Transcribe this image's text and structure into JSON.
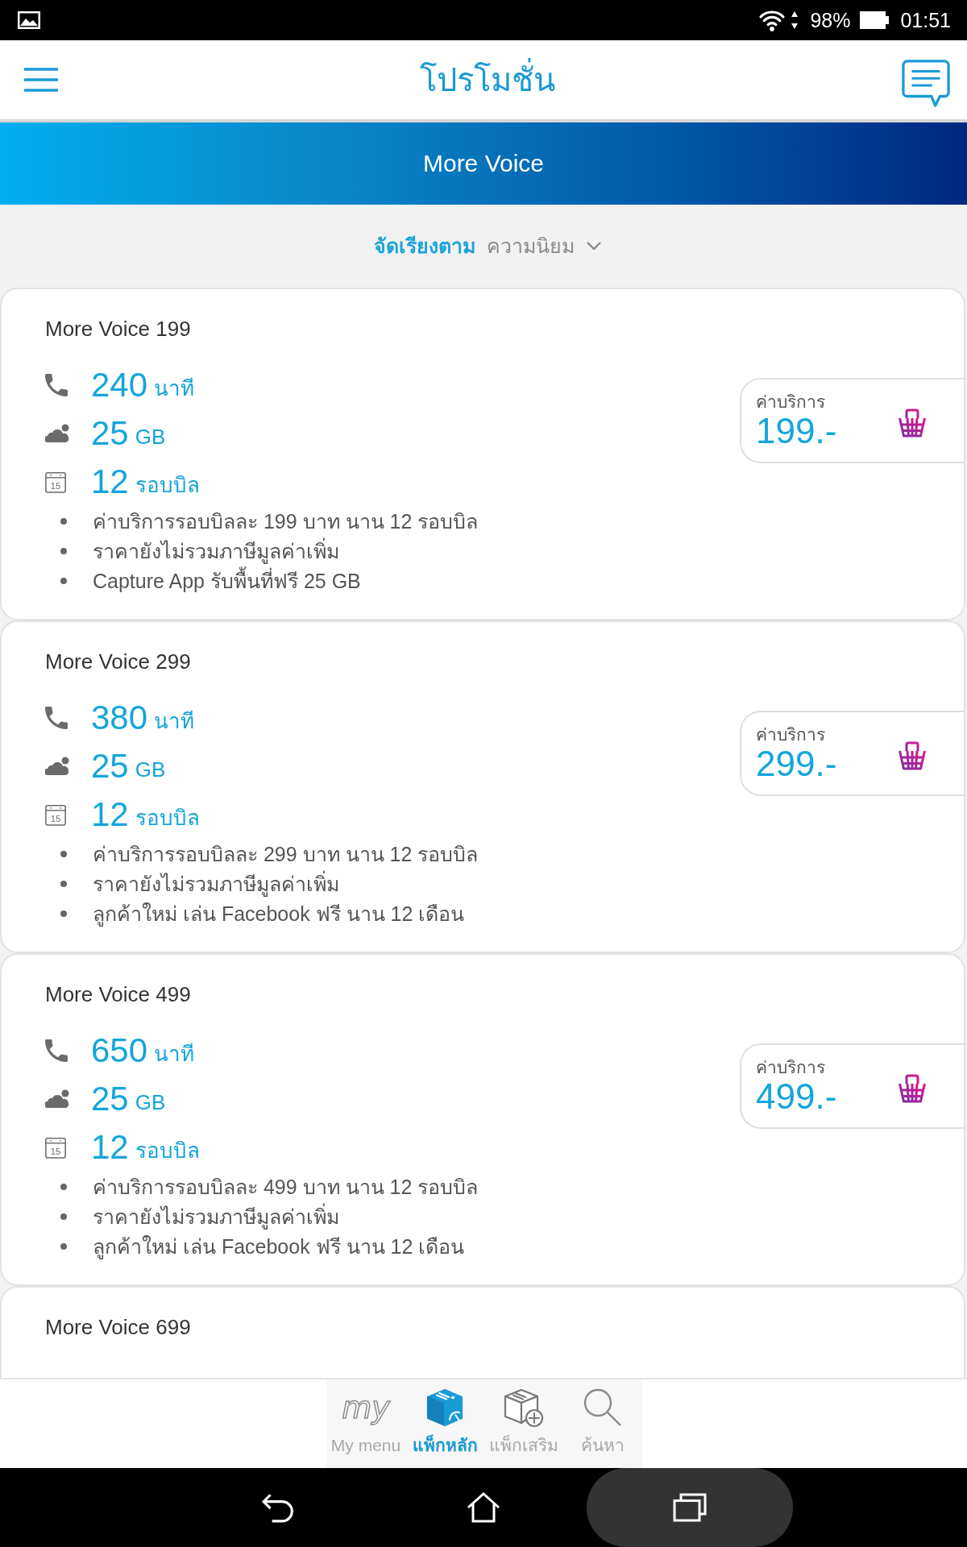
{
  "status_bar": {
    "battery": "98%",
    "time": "01:51"
  },
  "header": {
    "title": "โปรโมชั่น"
  },
  "banner": {
    "title": "More Voice"
  },
  "sort": {
    "label": "จัดเรียงตาม",
    "value": "ความนิยม"
  },
  "packages": [
    {
      "name": "More Voice 199",
      "features": [
        {
          "kind": "voice",
          "amount": "240",
          "unit": "นาที"
        },
        {
          "kind": "data",
          "amount": "25",
          "unit": "GB"
        },
        {
          "kind": "cycles",
          "icon_text": "15",
          "amount": "12",
          "unit": "รอบบิล"
        }
      ],
      "notes": [
        "ค่าบริการรอบบิลละ 199 บาท นาน 12 รอบบิล",
        "ราคายังไม่รวมภาษีมูลค่าเพิ่ม",
        "Capture App รับพื้นที่ฟรี 25 GB"
      ],
      "price_label": "ค่าบริการ",
      "price": "199.-"
    },
    {
      "name": "More Voice 299",
      "features": [
        {
          "kind": "voice",
          "amount": "380",
          "unit": "นาที"
        },
        {
          "kind": "data",
          "amount": "25",
          "unit": "GB"
        },
        {
          "kind": "cycles",
          "icon_text": "15",
          "amount": "12",
          "unit": "รอบบิล"
        }
      ],
      "notes": [
        "ค่าบริการรอบบิลละ 299 บาท นาน 12 รอบบิล",
        "ราคายังไม่รวมภาษีมูลค่าเพิ่ม",
        "ลูกค้าใหม่ เล่น Facebook ฟรี นาน 12 เดือน"
      ],
      "price_label": "ค่าบริการ",
      "price": "299.-"
    },
    {
      "name": "More Voice 499",
      "features": [
        {
          "kind": "voice",
          "amount": "650",
          "unit": "นาที"
        },
        {
          "kind": "data",
          "amount": "25",
          "unit": "GB"
        },
        {
          "kind": "cycles",
          "icon_text": "15",
          "amount": "12",
          "unit": "รอบบิล"
        }
      ],
      "notes": [
        "ค่าบริการรอบบิลละ 499 บาท นาน 12 รอบบิล",
        "ราคายังไม่รวมภาษีมูลค่าเพิ่ม",
        "ลูกค้าใหม่ เล่น Facebook ฟรี นาน 12 เดือน"
      ],
      "price_label": "ค่าบริการ",
      "price": "499.-"
    },
    {
      "name": "More Voice 699"
    }
  ],
  "bottom_nav": [
    {
      "kind": "my",
      "icon_text": "my",
      "label": "My menu",
      "selected": false
    },
    {
      "kind": "main",
      "label": "แพ็กหลัก",
      "selected": true
    },
    {
      "kind": "addon",
      "label": "แพ็กเสริม",
      "selected": false
    },
    {
      "kind": "search",
      "label": "ค้นหา",
      "selected": false
    }
  ]
}
